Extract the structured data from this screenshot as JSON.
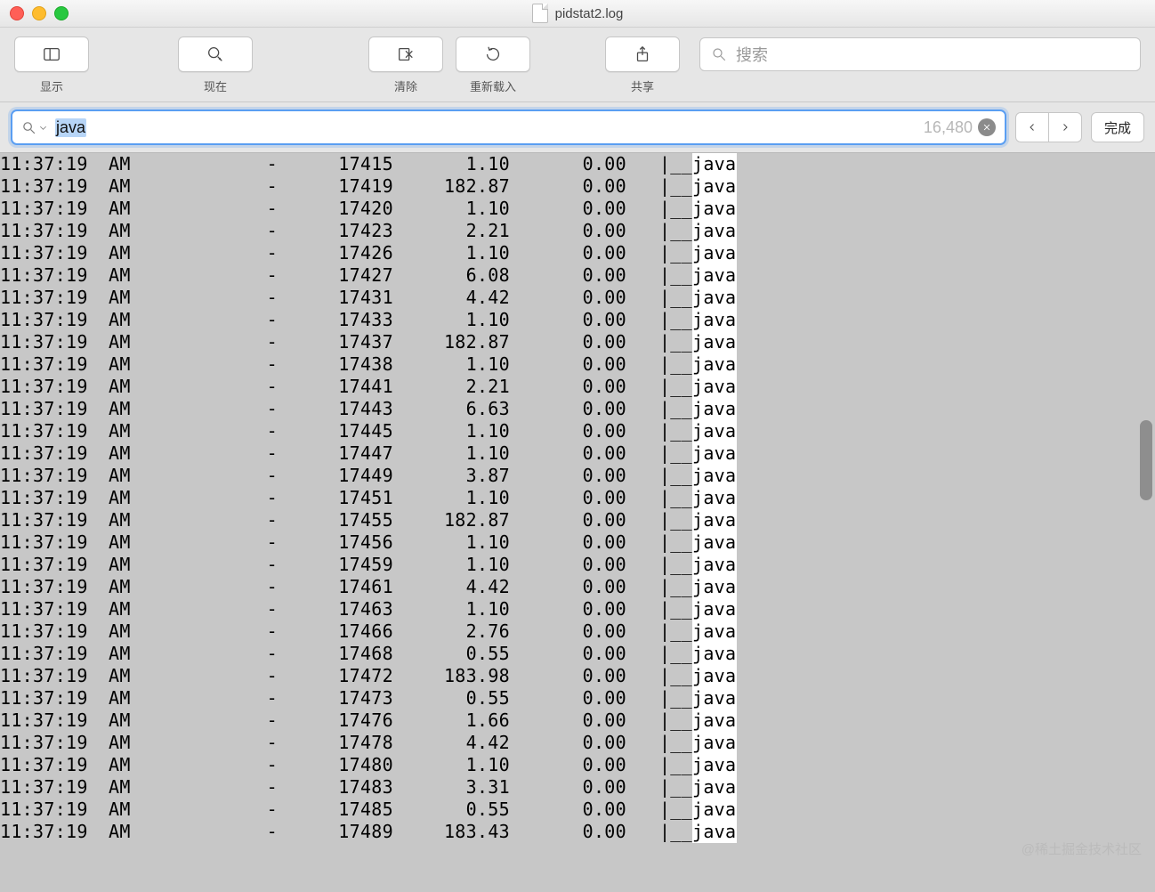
{
  "window_title": "pidstat2.log",
  "toolbar": {
    "show_label": "显示",
    "now_label": "现在",
    "clear_label": "清除",
    "reload_label": "重新载入",
    "share_label": "共享",
    "search_placeholder": "搜索"
  },
  "findbar": {
    "value": "java",
    "count": "16,480",
    "done_label": "完成"
  },
  "columns": {
    "time_value": "11:37:19",
    "ampm": "AM",
    "dash": "-",
    "tree": "|__",
    "proc": "java"
  },
  "rows": [
    {
      "pid": "17415",
      "v1": "1.10",
      "v2": "0.00"
    },
    {
      "pid": "17419",
      "v1": "182.87",
      "v2": "0.00"
    },
    {
      "pid": "17420",
      "v1": "1.10",
      "v2": "0.00"
    },
    {
      "pid": "17423",
      "v1": "2.21",
      "v2": "0.00"
    },
    {
      "pid": "17426",
      "v1": "1.10",
      "v2": "0.00"
    },
    {
      "pid": "17427",
      "v1": "6.08",
      "v2": "0.00"
    },
    {
      "pid": "17431",
      "v1": "4.42",
      "v2": "0.00"
    },
    {
      "pid": "17433",
      "v1": "1.10",
      "v2": "0.00"
    },
    {
      "pid": "17437",
      "v1": "182.87",
      "v2": "0.00"
    },
    {
      "pid": "17438",
      "v1": "1.10",
      "v2": "0.00"
    },
    {
      "pid": "17441",
      "v1": "2.21",
      "v2": "0.00"
    },
    {
      "pid": "17443",
      "v1": "6.63",
      "v2": "0.00"
    },
    {
      "pid": "17445",
      "v1": "1.10",
      "v2": "0.00"
    },
    {
      "pid": "17447",
      "v1": "1.10",
      "v2": "0.00"
    },
    {
      "pid": "17449",
      "v1": "3.87",
      "v2": "0.00"
    },
    {
      "pid": "17451",
      "v1": "1.10",
      "v2": "0.00"
    },
    {
      "pid": "17455",
      "v1": "182.87",
      "v2": "0.00"
    },
    {
      "pid": "17456",
      "v1": "1.10",
      "v2": "0.00"
    },
    {
      "pid": "17459",
      "v1": "1.10",
      "v2": "0.00"
    },
    {
      "pid": "17461",
      "v1": "4.42",
      "v2": "0.00"
    },
    {
      "pid": "17463",
      "v1": "1.10",
      "v2": "0.00"
    },
    {
      "pid": "17466",
      "v1": "2.76",
      "v2": "0.00"
    },
    {
      "pid": "17468",
      "v1": "0.55",
      "v2": "0.00"
    },
    {
      "pid": "17472",
      "v1": "183.98",
      "v2": "0.00"
    },
    {
      "pid": "17473",
      "v1": "0.55",
      "v2": "0.00"
    },
    {
      "pid": "17476",
      "v1": "1.66",
      "v2": "0.00"
    },
    {
      "pid": "17478",
      "v1": "4.42",
      "v2": "0.00"
    },
    {
      "pid": "17480",
      "v1": "1.10",
      "v2": "0.00"
    },
    {
      "pid": "17483",
      "v1": "3.31",
      "v2": "0.00"
    },
    {
      "pid": "17485",
      "v1": "0.55",
      "v2": "0.00"
    },
    {
      "pid": "17489",
      "v1": "183.43",
      "v2": "0.00"
    }
  ],
  "watermark": "@稀土掘金技术社区"
}
